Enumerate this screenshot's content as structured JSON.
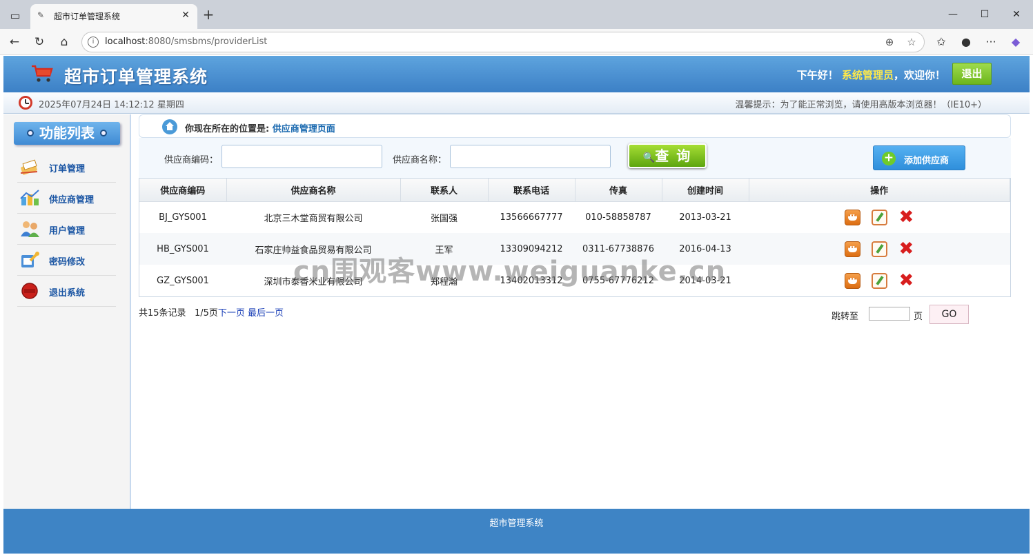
{
  "browser": {
    "tab_title": "超市订单管理系统",
    "url_host": "localhost",
    "url_rest": ":8080/smsbms/providerList"
  },
  "header": {
    "app_title": "超市订单管理系统",
    "greeting_prefix": "下午好！",
    "username": "系统管理员",
    "greeting_suffix": "，欢迎你！",
    "logout_label": "退出"
  },
  "infobar": {
    "datetime": "2025年07月24日 14:12:12 星期四",
    "tip": "温馨提示：为了能正常浏览，请使用高版本浏览器！（IE10+）"
  },
  "sidebar": {
    "title": "功能列表",
    "items": [
      {
        "label": "订单管理",
        "icon": "order-icon"
      },
      {
        "label": "供应商管理",
        "icon": "provider-icon"
      },
      {
        "label": "用户管理",
        "icon": "users-icon"
      },
      {
        "label": "密码修改",
        "icon": "password-icon"
      },
      {
        "label": "退出系统",
        "icon": "exit-icon"
      }
    ]
  },
  "breadcrumb": {
    "prefix": "你现在所在的位置是:",
    "location": "供应商管理页面"
  },
  "search": {
    "code_label": "供应商编码：",
    "code_value": "",
    "name_label": "供应商名称：",
    "name_value": "",
    "query_label": "查 询",
    "add_label": "添加供应商"
  },
  "table": {
    "headers": [
      "供应商编码",
      "供应商名称",
      "联系人",
      "联系电话",
      "传真",
      "创建时间",
      "操作"
    ],
    "rows": [
      [
        "BJ_GYS001",
        "北京三木堂商贸有限公司",
        "张国强",
        "13566667777",
        "010-58858787",
        "2013-03-21"
      ],
      [
        "HB_GYS001",
        "石家庄帅益食品贸易有限公司",
        "王军",
        "13309094212",
        "0311-67738876",
        "2016-04-13"
      ],
      [
        "GZ_GYS001",
        "深圳市泰香米业有限公司",
        "郑程瀚",
        "13402013312",
        "0755-67776212",
        "2014-03-21"
      ]
    ]
  },
  "pager": {
    "total": "共15条记录",
    "current": "1/5页",
    "next": "下一页",
    "last": "最后一页",
    "jump_label": "跳转至",
    "page_unit": "页",
    "go_label": "GO",
    "jump_value": ""
  },
  "watermark": "cn围观客www.weiguanke.cn",
  "footer": {
    "text": "超市管理系统"
  }
}
